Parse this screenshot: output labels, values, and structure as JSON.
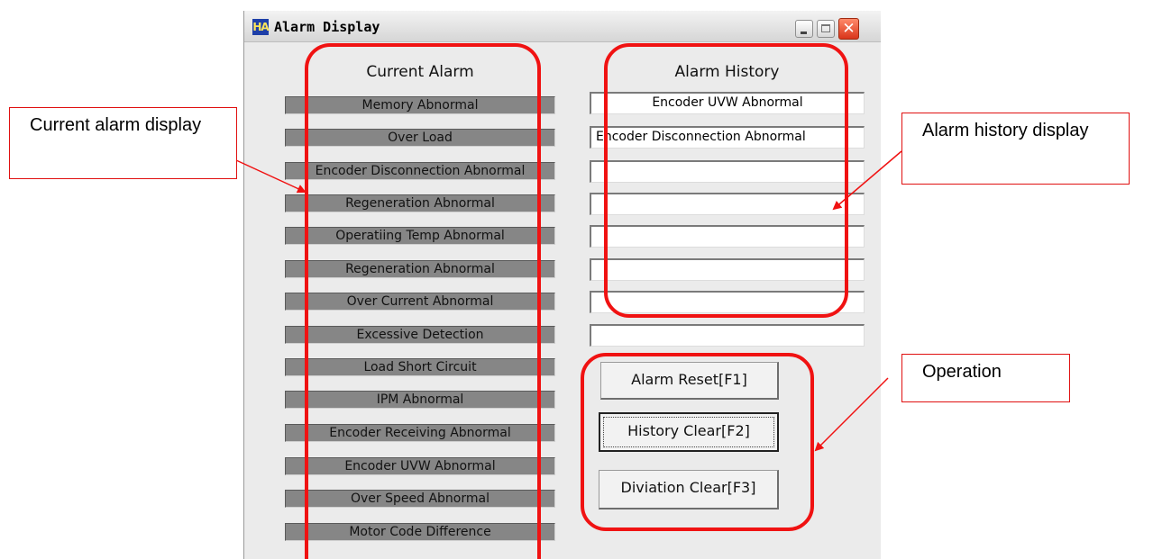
{
  "window": {
    "title": "Alarm Display",
    "icon": "app-icon"
  },
  "current_alarm": {
    "header": "Current Alarm",
    "items": [
      "Memory Abnormal",
      "Over Load",
      "Encoder Disconnection Abnormal",
      "Regeneration Abnormal",
      "Operatiing Temp Abnormal",
      "Regeneration Abnormal",
      "Over Current Abnormal",
      "Excessive Detection",
      "Load Short Circuit",
      "IPM Abnormal",
      "Encoder Receiving Abnormal",
      "Encoder UVW Abnormal",
      "Over Speed Abnormal",
      "Motor Code Difference"
    ]
  },
  "alarm_history": {
    "header": "Alarm History",
    "entries": [
      "Encoder UVW Abnormal",
      "Encoder Disconnection Abnormal",
      "",
      "",
      "",
      "",
      "",
      ""
    ]
  },
  "operation": {
    "alarm_reset": "Alarm Reset[F1]",
    "history_clear": "History Clear[F2]",
    "deviation_clear": "Diviation Clear[F3]"
  },
  "annotations": {
    "current_alarm_display": "Current alarm display",
    "alarm_history_display": "Alarm history display",
    "operation": "Operation",
    "highlight_color": "#f01212"
  }
}
